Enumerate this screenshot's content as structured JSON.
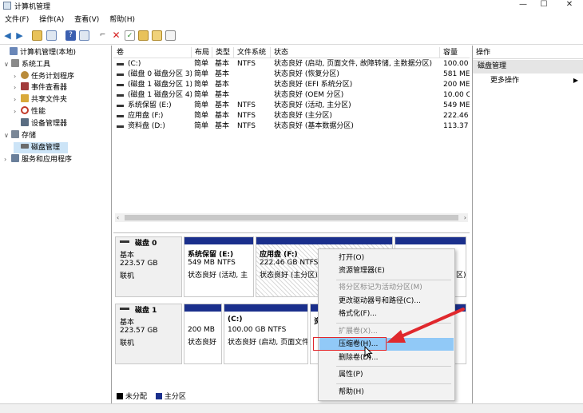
{
  "window": {
    "title": "计算机管理",
    "controls": [
      "—",
      "☐",
      "✕"
    ]
  },
  "menu": [
    "文件(F)",
    "操作(A)",
    "查看(V)",
    "帮助(H)"
  ],
  "toolbar_icons": [
    "back-icon",
    "forward-icon",
    "up-folder-icon",
    "show-hide-tree-icon",
    "help-icon",
    "panel-icon",
    "connect-icon",
    "delete-icon",
    "check-icon",
    "folder-icon",
    "search-folder-icon",
    "properties-icon"
  ],
  "tree": [
    {
      "label": "计算机管理(本地)",
      "icon": "computer-icon",
      "color": "#6a87b8",
      "exp": "",
      "level": 0
    },
    {
      "label": "系统工具",
      "icon": "tools-icon",
      "color": "#8a8a8a",
      "exp": "∨",
      "level": 1
    },
    {
      "label": "任务计划程序",
      "icon": "clock-icon",
      "color": "#b98b3a",
      "exp": "›",
      "level": 2
    },
    {
      "label": "事件查看器",
      "icon": "event-viewer-icon",
      "color": "#a23b3b",
      "exp": "›",
      "level": 2
    },
    {
      "label": "共享文件夹",
      "icon": "shared-folder-icon",
      "color": "#d9a93a",
      "exp": "›",
      "level": 2
    },
    {
      "label": "性能",
      "icon": "performance-icon",
      "color": "#c23a2a",
      "exp": "›",
      "level": 2
    },
    {
      "label": "设备管理器",
      "icon": "device-manager-icon",
      "color": "#5a6d82",
      "exp": "",
      "level": 2
    },
    {
      "label": "存储",
      "icon": "storage-icon",
      "color": "#7a8797",
      "exp": "∨",
      "level": 1
    },
    {
      "label": "磁盘管理",
      "icon": "disk-management-icon",
      "color": "#6b6b6b",
      "exp": "",
      "level": 2,
      "selected": true
    },
    {
      "label": "服务和应用程序",
      "icon": "services-icon",
      "color": "#6a7f9a",
      "exp": "›",
      "level": 1
    }
  ],
  "volumes": {
    "headers": [
      "卷",
      "布局",
      "类型",
      "文件系统",
      "状态",
      "容量"
    ],
    "rows": [
      [
        "(C:)",
        "简单",
        "基本",
        "NTFS",
        "状态良好 (启动, 页面文件, 故障转储, 主数据分区)",
        "100.00"
      ],
      [
        "(磁盘 0 磁盘分区 3)",
        "简单",
        "基本",
        "",
        "状态良好 (恢复分区)",
        "581 ME"
      ],
      [
        "(磁盘 1 磁盘分区 1)",
        "简单",
        "基本",
        "",
        "状态良好 (EFI 系统分区)",
        "200 ME"
      ],
      [
        "(磁盘 1 磁盘分区 4)",
        "简单",
        "基本",
        "",
        "状态良好 (OEM 分区)",
        "10.00 C"
      ],
      [
        "系统保留 (E:)",
        "简单",
        "基本",
        "NTFS",
        "状态良好 (活动, 主分区)",
        "549 ME"
      ],
      [
        "应用盘 (F:)",
        "简单",
        "基本",
        "NTFS",
        "状态良好 (主分区)",
        "222.46"
      ],
      [
        "资料盘 (D:)",
        "简单",
        "基本",
        "NTFS",
        "状态良好 (基本数据分区)",
        "113.37"
      ]
    ]
  },
  "disks": [
    {
      "name": "磁盘 0",
      "type": "基本",
      "size": "223.57 GB",
      "status": "联机",
      "partitions": [
        {
          "name": "系统保留  (E:)",
          "size": "549 MB NTFS",
          "status": "状态良好 (活动, 主"
        },
        {
          "name": "应用盘  (F:)",
          "size": "222.46 GB NTFS",
          "status": "状态良好 (主分区)"
        },
        {
          "name": "",
          "size": "",
          "status": "区)"
        }
      ]
    },
    {
      "name": "磁盘 1",
      "type": "基本",
      "size": "223.57 GB",
      "status": "联机",
      "partitions": [
        {
          "name": "",
          "size": "200 MB",
          "status": "状态良好"
        },
        {
          "name": "(C:)",
          "size": "100.00 GB NTFS",
          "status": "状态良好 (启动, 页面文件"
        },
        {
          "name": "资",
          "size": "",
          "status": ""
        },
        {
          "name": "",
          "size": "",
          "status": ""
        }
      ]
    }
  ],
  "legend": [
    {
      "label": "未分配",
      "color": "#000000"
    },
    {
      "label": "主分区",
      "color": "#1a2f8c"
    }
  ],
  "actions": {
    "header": "操作",
    "section": "磁盘管理",
    "more": "更多操作"
  },
  "context_menu": [
    {
      "label": "打开(O)",
      "disabled": false
    },
    {
      "label": "资源管理器(E)",
      "disabled": false
    },
    {
      "sep": true
    },
    {
      "label": "将分区标记为活动分区(M)",
      "disabled": true
    },
    {
      "label": "更改驱动器号和路径(C)...",
      "disabled": false
    },
    {
      "label": "格式化(F)...",
      "disabled": false
    },
    {
      "sep": true
    },
    {
      "label": "扩展卷(X)...",
      "disabled": true
    },
    {
      "label": "压缩卷(H)...",
      "disabled": false,
      "highlighted": true
    },
    {
      "label": "删除卷(D)...",
      "disabled": false
    },
    {
      "sep": true
    },
    {
      "label": "属性(P)",
      "disabled": false
    },
    {
      "sep": true
    },
    {
      "label": "帮助(H)",
      "disabled": false
    }
  ],
  "colors": {
    "accent_highlight": "#91c9f7",
    "primary_partition": "#1a2f8c",
    "callout": "#e0282d",
    "selected_tree": "#cce4f7"
  }
}
